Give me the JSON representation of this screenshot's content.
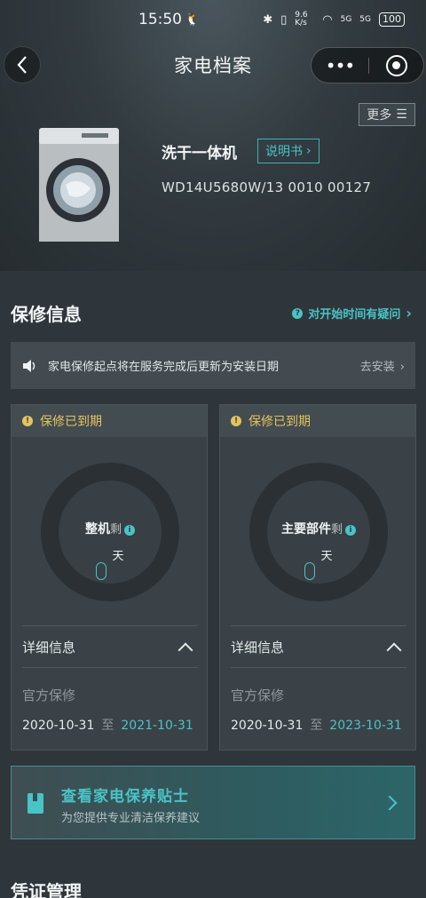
{
  "status_bar": {
    "time": "15:50",
    "battery": "100",
    "speed": "9.6 K/s",
    "signal1": "5G",
    "signal2": "5G"
  },
  "nav": {
    "title": "家电档案",
    "more_label": "更多"
  },
  "product": {
    "name": "洗干一体机",
    "manual_label": "说明书",
    "model": "WD14U5680W/13 0010 00127"
  },
  "warranty": {
    "title": "保修信息",
    "question_link": "对开始时间有疑问",
    "notice": {
      "text": "家电保修起点将在服务完成后更新为安装日期",
      "action": "去安装"
    },
    "cards": [
      {
        "status": "保修已到期",
        "label": "整机",
        "remaining": "剩",
        "days_value": "0",
        "days_unit": "天",
        "detail_label": "详细信息",
        "type": "官方保修",
        "start": "2020-10-31",
        "to": "至",
        "end": "2021-10-31"
      },
      {
        "status": "保修已到期",
        "label": "主要部件",
        "remaining": "剩",
        "days_value": "0",
        "days_unit": "天",
        "detail_label": "详细信息",
        "type": "官方保修",
        "start": "2020-10-31",
        "to": "至",
        "end": "2023-10-31"
      }
    ]
  },
  "tips": {
    "title": "查看家电保养贴士",
    "subtitle": "为您提供专业清洁保养建议"
  },
  "voucher": {
    "title": "凭证管理"
  },
  "colors": {
    "accent": "#49c3c6",
    "warning": "#e5c45e",
    "background": "#2f363b"
  },
  "icons": [
    "back-icon",
    "more-dots-icon",
    "close-mini-program-icon",
    "menu-icon",
    "chevron-right-icon",
    "question-icon",
    "speaker-icon",
    "warning-icon",
    "info-icon",
    "chevron-up-icon",
    "book-icon"
  ]
}
